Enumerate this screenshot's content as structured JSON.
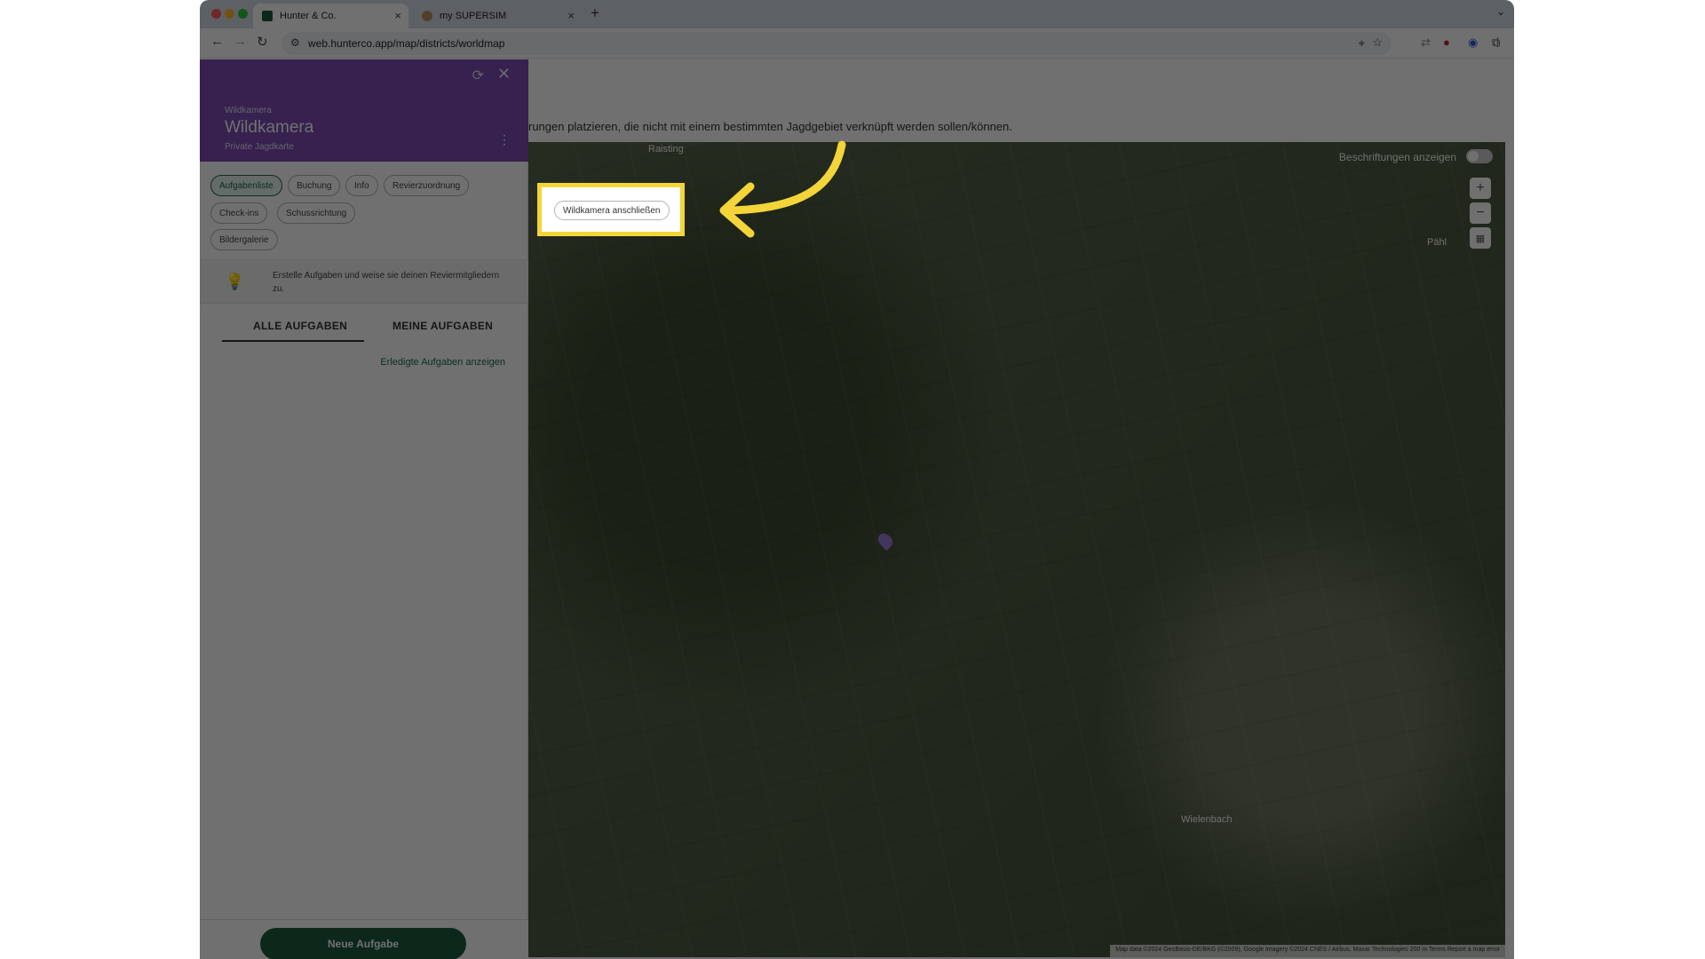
{
  "browser": {
    "tabs": [
      {
        "title": "Hunter & Co.",
        "active": true
      },
      {
        "title": "my SUPERSIM",
        "active": false
      }
    ],
    "new_tab_symbol": "+",
    "url": "web.hunterco.app/map/districts/worldmap"
  },
  "page": {
    "description": "rungen platzieren, die nicht mit einem bestimmten Jagdgebiet verknüpft werden sollen/können."
  },
  "panel": {
    "subtitle": "Wildkamera",
    "title": "Wildkamera",
    "caption": "Private Jagdkarte",
    "chips": [
      "Aufgabenliste",
      "Buchung",
      "Info",
      "Revierzuordnung",
      "Check-ins",
      "Schussrichtung",
      "Bildergalerie"
    ],
    "highlighted_chip": "Wildkamera anschließen",
    "hint": "Erstelle Aufgaben und weise sie deinen Reviermitgliedern zu.",
    "tabs": [
      "ALLE AUFGABEN",
      "MEINE AUFGABEN"
    ],
    "done_link": "Erledigte Aufgaben anzeigen",
    "new_task_button": "Neue Aufgabe"
  },
  "map": {
    "labels_toggle": "Beschriftungen anzeigen",
    "zoom_in": "+",
    "zoom_out": "−",
    "places": [
      "Raisting",
      "Pähl",
      "Wielenbach"
    ],
    "footer": "Map data ©2024 GeoBasis-DE/BKG (©2009), Google Imagery ©2024 CNES / Airbus, Maxar Technologies  200 m  Terms  Report a map error"
  },
  "colors": {
    "header_purple": "#7b4bb3",
    "primary_green": "#1a5c3e",
    "highlight_yellow": "#f3d53a"
  }
}
